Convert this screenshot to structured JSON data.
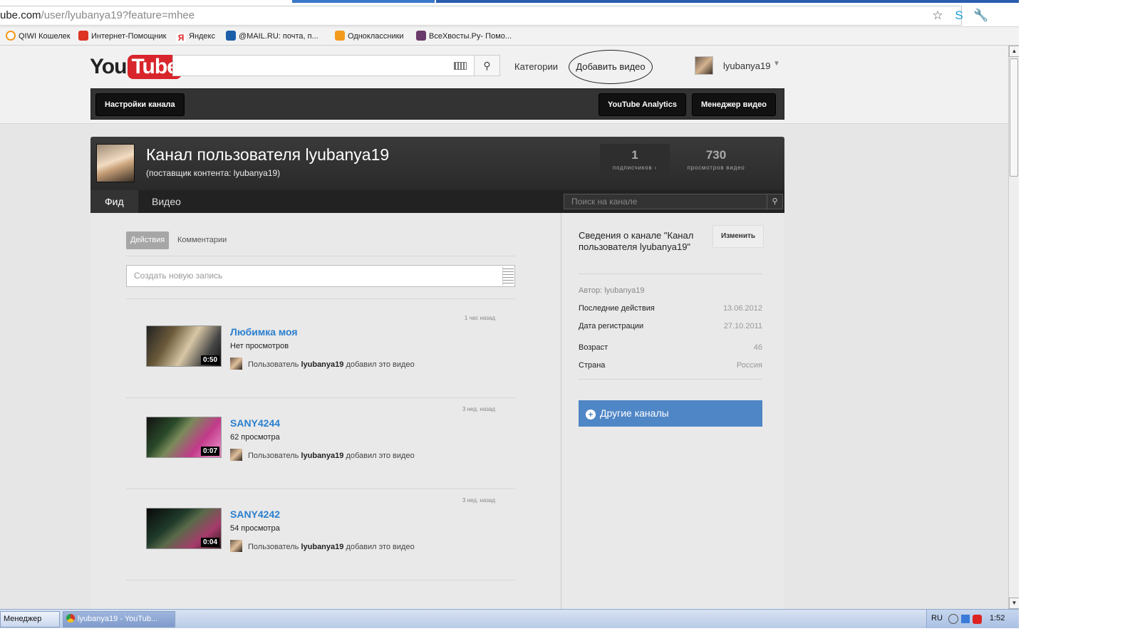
{
  "browser": {
    "url_host": "ube.com",
    "url_path": "/user/lyubanya19?feature=mhee",
    "bookmarks": [
      "QIWI Кошелек",
      "Интернет-Помощник",
      "Яндекс",
      "@MAIL.RU: почта, п...",
      "Одноклассники",
      "ВсеХвосты.Ру- Помо..."
    ]
  },
  "header": {
    "logo_you": "You",
    "logo_tube": "Tube",
    "categories": "Категории",
    "upload": "Добавить видео",
    "username": "lyubanya19"
  },
  "toolbar": {
    "channel_settings": "Настройки канала",
    "analytics": "YouTube Analytics",
    "video_manager": "Менеджер видео"
  },
  "channel": {
    "title": "Канал пользователя lyubanya19",
    "subtitle": "(поставщик контента: lyubanya19)",
    "subscribers": {
      "value": "1",
      "label": "подписчиков ›"
    },
    "views": {
      "value": "730",
      "label": "просмотров видео"
    },
    "tabs": [
      "Фид",
      "Видео"
    ],
    "search_placeholder": "Поиск на канале"
  },
  "feed": {
    "tabs": [
      "Действия",
      "Комментарии"
    ],
    "compose_placeholder": "Создать новую запись",
    "items": [
      {
        "time": "1 час назад",
        "title": "Любимка моя",
        "views": "Нет просмотров",
        "duration": "0:50",
        "action_pre": "Пользователь",
        "action_user": "lyubanya19",
        "action_post": "добавил это видео"
      },
      {
        "time": "3 нед. назад",
        "title": "SANY4244",
        "views": "62 просмотра",
        "duration": "0:07",
        "action_pre": "Пользователь",
        "action_user": "lyubanya19",
        "action_post": "добавил это видео"
      },
      {
        "time": "3 нед. назад",
        "title": "SANY4242",
        "views": "54 просмотра",
        "duration": "0:04",
        "action_pre": "Пользователь",
        "action_user": "lyubanya19",
        "action_post": "добавил это видео"
      }
    ]
  },
  "about": {
    "title": "Сведения о канале \"Канал пользователя lyubanya19\"",
    "edit": "Изменить",
    "author": "Автор: lyubanya19",
    "rows": [
      {
        "k": "Последние действия",
        "v": "13.06.2012"
      },
      {
        "k": "Дата регистрации",
        "v": "27.10.2011"
      },
      {
        "k": "Возраст",
        "v": "46"
      },
      {
        "k": "Страна",
        "v": "Россия"
      }
    ],
    "other_channels": "Другие каналы"
  },
  "taskbar": {
    "task1": "Менеджер",
    "task2": "lyubanya19 - YouTub...",
    "lang": "RU",
    "clock": "1:52"
  }
}
